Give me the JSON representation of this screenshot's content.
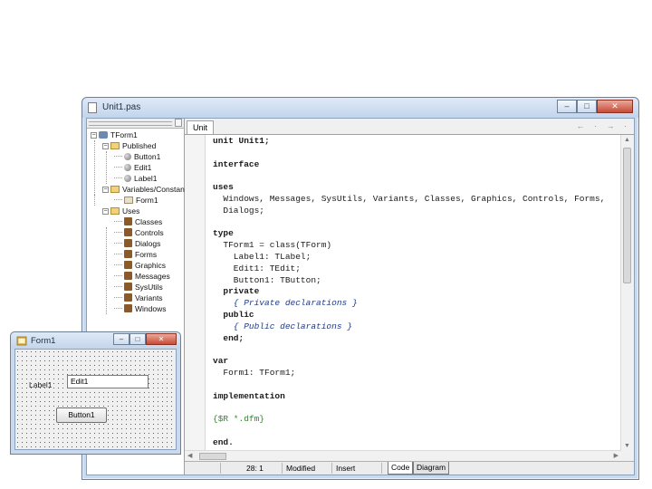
{
  "editor": {
    "title": "Unit1.pas",
    "tab_label": "Unit",
    "nav_arrows": "← · → ·",
    "caption_min": "–",
    "caption_max": "□",
    "caption_close": "✕"
  },
  "tree": [
    {
      "label": "TForm1",
      "icon": "component-icon"
    },
    {
      "label": "Published",
      "icon": "folder-icon"
    },
    {
      "label": "Button1",
      "icon": "field-icon"
    },
    {
      "label": "Edit1",
      "icon": "field-icon"
    },
    {
      "label": "Label1",
      "icon": "field-icon"
    },
    {
      "label": "Variables/Constants",
      "icon": "folder-icon"
    },
    {
      "label": "Form1",
      "icon": "form-icon"
    },
    {
      "label": "Uses",
      "icon": "folder-icon"
    },
    {
      "label": "Classes",
      "icon": "unit-icon"
    },
    {
      "label": "Controls",
      "icon": "unit-icon"
    },
    {
      "label": "Dialogs",
      "icon": "unit-icon"
    },
    {
      "label": "Forms",
      "icon": "unit-icon"
    },
    {
      "label": "Graphics",
      "icon": "unit-icon"
    },
    {
      "label": "Messages",
      "icon": "unit-icon"
    },
    {
      "label": "SysUtils",
      "icon": "unit-icon"
    },
    {
      "label": "Variants",
      "icon": "unit-icon"
    },
    {
      "label": "Windows",
      "icon": "unit-icon"
    }
  ],
  "code": [
    "unit Unit1;",
    "",
    "interface",
    "",
    "uses",
    "  Windows, Messages, SysUtils, Variants, Classes, Graphics, Controls, Forms,",
    "  Dialogs;",
    "",
    "type",
    "  TForm1 = class(TForm)",
    "    Label1: TLabel;",
    "    Edit1: TEdit;",
    "    Button1: TButton;",
    "  private",
    "    { Private declarations }",
    "  public",
    "    { Public declarations }",
    "  end;",
    "",
    "var",
    "  Form1: TForm1;",
    "",
    "implementation",
    "",
    "{$R *.dfm}",
    "",
    "end."
  ],
  "status": {
    "position": "28:  1",
    "modified": "Modified",
    "insert": "Insert",
    "tab_code": "Code",
    "tab_diagram": "Diagram"
  },
  "form": {
    "title": "Form1",
    "label": "Label1",
    "edit_value": "Edit1",
    "button_label": "Button1"
  }
}
